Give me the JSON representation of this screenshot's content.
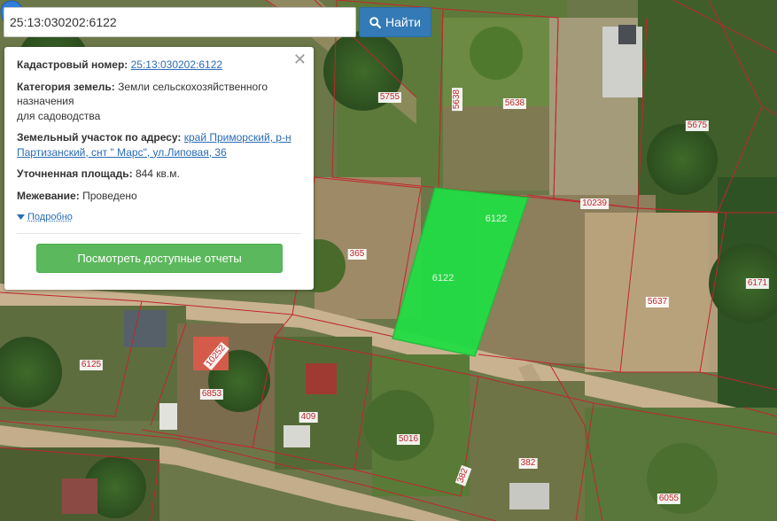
{
  "search": {
    "value": "25:13:030202:6122",
    "button_label": "Найти",
    "button_icon": "search-icon"
  },
  "info": {
    "cadastral_label": "Кадастровый номер:",
    "cadastral_value": "25:13:030202:6122",
    "category_label": "Категория земель:",
    "category_value": "Земли сельскохозяйственного назначения",
    "category_value_2": "для садоводства",
    "address_label": "Земельный участок по адресу:",
    "address_value": "край Приморский, р-н Партизанский, снт \" Марс\", ул.Липовая, 36",
    "area_label": "Уточненная площадь:",
    "area_value": "844 кв.м.",
    "survey_label": "Межевание:",
    "survey_value": "Проведено",
    "details_label": "Подробно",
    "reports_button": "Посмотреть доступные отчеты",
    "close_icon": "close-icon"
  },
  "map": {
    "selected_parcel": "6122",
    "selected_color": "#22dd44",
    "boundary_color": "#c0262c",
    "parcel_labels": [
      "5755",
      "5638",
      "5638",
      "5675",
      "10239",
      "365",
      "6122",
      "6122",
      "5637",
      "6171",
      "6125",
      "10252",
      "6853",
      "409",
      "5016",
      "382",
      "382",
      "6055"
    ]
  }
}
